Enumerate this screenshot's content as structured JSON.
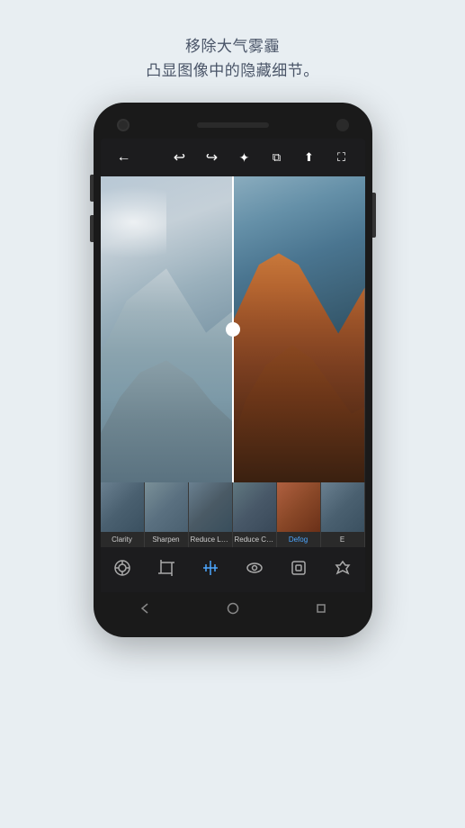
{
  "header": {
    "line1": "移除大气雾霾",
    "line2": "凸显图像中的隐藏细节。"
  },
  "toolbar": {
    "back_label": "←",
    "undo_label": "↩",
    "redo_label": "↪",
    "auto_label": "✦",
    "compare_label": "⧉",
    "share_label": "⬆",
    "fullscreen_label": "⛶"
  },
  "thumbnails": [
    {
      "label": "Clarity",
      "active": false
    },
    {
      "label": "Sharpen",
      "active": false
    },
    {
      "label": "Reduce Lumi..",
      "active": false
    },
    {
      "label": "Reduce Colo..",
      "active": false
    },
    {
      "label": "Defog",
      "active": true
    },
    {
      "label": "E",
      "active": false
    }
  ],
  "bottom_tools": [
    {
      "icon": "⊙",
      "label": "presets",
      "active": false
    },
    {
      "icon": "⊡",
      "label": "crop",
      "active": false
    },
    {
      "icon": "⊟",
      "label": "detail",
      "active": true
    },
    {
      "icon": "◉",
      "label": "view",
      "active": false
    },
    {
      "icon": "⬡",
      "label": "selective",
      "active": false
    },
    {
      "icon": "✱",
      "label": "healing",
      "active": false
    }
  ],
  "nav": {
    "back_label": "◀",
    "home_label": "●",
    "recent_label": "■"
  }
}
